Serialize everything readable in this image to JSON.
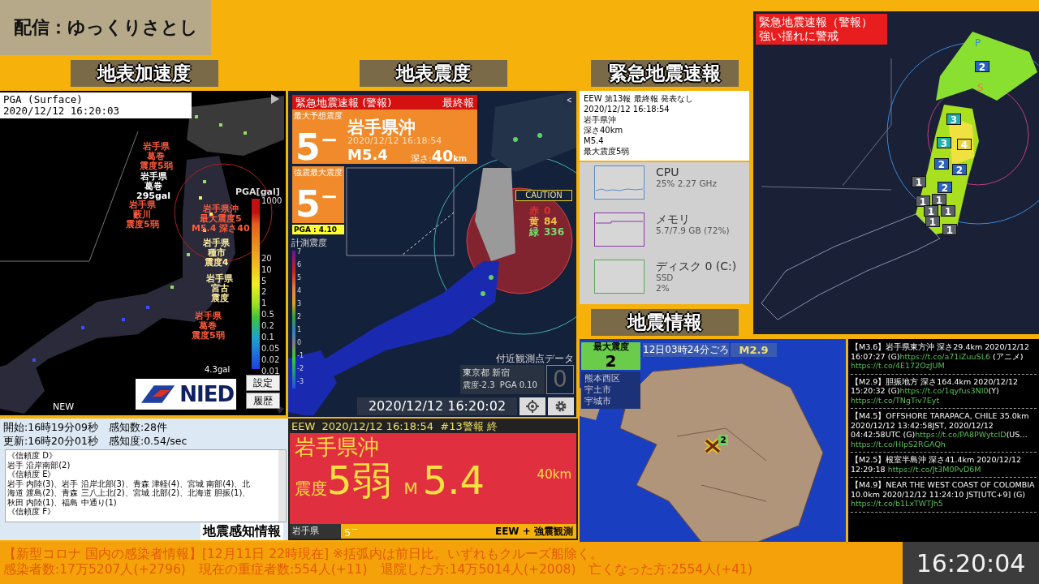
{
  "stream_banner": {
    "text": "配信：ゆっくりさとし"
  },
  "pga_panel": {
    "header": "地表加速度",
    "title": "PGA (Surface)",
    "timestamp": "2020/12/12 16:20:03",
    "scale_title": "PGA[gal]",
    "scale_ticks": [
      "1000",
      "20",
      "10",
      "5",
      "2",
      "1",
      "0.5",
      "0.2",
      "0.1",
      "0.05",
      "0.02",
      "0.01"
    ],
    "map_labels": [
      {
        "lines": [
          "岩手県",
          "葛巻",
          "震度5弱"
        ],
        "color": "#ff5a3c"
      },
      {
        "lines": [
          "岩手県",
          "葛巻",
          "295gal"
        ],
        "color": "#ffffff"
      },
      {
        "lines": [
          "岩手県",
          "藪川",
          "震度5弱"
        ],
        "color": "#ff5a3c"
      },
      {
        "lines": [
          "岩手県沖",
          "最大震度5",
          "M5.4 深さ40"
        ],
        "color": "#ff5a3c"
      },
      {
        "lines": [
          "岩手県",
          "種市",
          "震度4"
        ],
        "color": "#fff0a0"
      },
      {
        "lines": [
          "岩手県",
          "宮古",
          "震度"
        ],
        "color": "#fff0a0"
      },
      {
        "lines": [
          "岩手県",
          "葛巻",
          "震度5弱"
        ],
        "color": "#ff5a3c"
      }
    ],
    "peak_label": "4.3gal",
    "logo_text": "NIED",
    "new_label": "NEW",
    "buttons": [
      "設定",
      "履歴"
    ]
  },
  "shindo_panel": {
    "header": "地表震度",
    "alert_title": "緊急地震速報 (警報)",
    "alert_status": "最終報",
    "forecast_label": "最大予想震度",
    "forecast_value": "5$^{−}$",
    "region": "岩手県沖",
    "origin_time": "2020/12/12 16:18:54",
    "magnitude": "M5.4",
    "depth_label": "深さ:",
    "depth_value": "40",
    "depth_unit": "km",
    "observed_label": "強震最大震度",
    "observed_value": "5$^{−}$",
    "pga": "PGA : 4.10",
    "scale_title": "計測震度",
    "scale_ticks": [
      "7",
      "6",
      "5",
      "4",
      "3",
      "2",
      "1",
      "0",
      "-1",
      "-2",
      "-3"
    ],
    "caution": "CAUTION",
    "counts": [
      {
        "label": "赤",
        "value": "0",
        "color": "#e03030"
      },
      {
        "label": "黄",
        "value": "84",
        "color": "#f0c040"
      },
      {
        "label": "緑",
        "value": "336",
        "color": "#70e070"
      }
    ],
    "nearby_title": "付近観測点データ",
    "nearby_place": "東京都 新宿",
    "nearby_values": "震度-2.3  PGA 0.10",
    "nearby_intensity": "0",
    "current_time": "2020/12/12 16:20:02",
    "collapse": "<"
  },
  "eew_text_panel": {
    "header": "緊急地震速報",
    "lines": [
      "EEW 第13報 最終報 発表なし",
      "2020/12/12 16:18:54",
      "岩手県沖",
      "深さ40km",
      "M5.4",
      "最大震度5弱"
    ]
  },
  "performance": [
    {
      "name": "CPU",
      "details": [
        "25%  2.27 GHz"
      ],
      "color": "#5a8cc8"
    },
    {
      "name": "メモリ",
      "details": [
        "5.7/7.9 GB (72%)"
      ],
      "color": "#8a3aa8"
    },
    {
      "name": "ディスク 0 (C:)",
      "details": [
        "SSD",
        "2%"
      ],
      "color": "#5aa85a"
    }
  ],
  "right_map": {
    "alert_lines": [
      "緊急地震速報（警報）",
      "強い揺れに警戒"
    ],
    "wave_labels": [
      "P",
      "S"
    ],
    "markers": [
      {
        "label": "2",
        "color": "#2a64c0"
      },
      {
        "label": "3",
        "color": "#20b0b0"
      },
      {
        "label": "3",
        "color": "#20b0b0"
      },
      {
        "label": "4",
        "color": "#e8d040"
      },
      {
        "label": "2",
        "color": "#2a64c0"
      },
      {
        "label": "2",
        "color": "#2a64c0"
      },
      {
        "label": "1",
        "color": "#5a6068"
      },
      {
        "label": "2",
        "color": "#2a64c0"
      },
      {
        "label": "1",
        "color": "#5a6068"
      },
      {
        "label": "1",
        "color": "#5a6068"
      },
      {
        "label": "1",
        "color": "#5a6068"
      },
      {
        "label": "1",
        "color": "#5a6068"
      },
      {
        "label": "1",
        "color": "#5a6068"
      },
      {
        "label": "1",
        "color": "#5a6068"
      }
    ]
  },
  "quake_info": {
    "header": "地震情報",
    "max_label": "最大震度",
    "max_value": "2",
    "time": "12日03時24分ごろ",
    "magnitude": "M2.9",
    "areas": [
      "熊本西区",
      "宇土市",
      "宇城市"
    ],
    "epicenter_intensity": "2"
  },
  "quake_feed": [
    {
      "parts": [
        {
          "kind": "text",
          "text": "【M3.6】岩手県東方沖 深さ29.4km 2020/12/12 16:07:27 (G)"
        },
        {
          "kind": "link",
          "text": "https://t.co/a71iZuuSL6"
        },
        {
          "kind": "text",
          "text": " (アニメ)"
        },
        {
          "kind": "link",
          "text": "https://t.co/4E172OzJUM"
        }
      ]
    },
    {
      "parts": [
        {
          "kind": "text",
          "text": "【M2.9】胆振地方 深さ164.4km 2020/12/12 15:20:32 (G)"
        },
        {
          "kind": "link",
          "text": "https://t.co/1qyfus3NI0"
        },
        {
          "kind": "text",
          "text": "(Y)"
        },
        {
          "kind": "link",
          "text": "https://t.co/TNgTiv7Eyt"
        }
      ]
    },
    {
      "parts": [
        {
          "kind": "text",
          "text": "【M4.5】OFFSHORE TARAPACA, CHILE 35.0km 2020/12/12 13:42:58JST, 2020/12/12 04:42:58UTC (G)"
        },
        {
          "kind": "link",
          "text": "https://t.co/PA8PWytcID"
        },
        {
          "kind": "text",
          "text": "(US… "
        },
        {
          "kind": "link",
          "text": "https://t.co/HIpS2RGAQh"
        }
      ]
    },
    {
      "parts": [
        {
          "kind": "text",
          "text": "【M2.5】根室半島沖 深さ41.4km 2020/12/12 12:29:18 "
        },
        {
          "kind": "link",
          "text": "https://t.co/Jt3M0PvD6M"
        }
      ]
    },
    {
      "parts": [
        {
          "kind": "text",
          "text": "【M4.9】NEAR THE WEST COAST OF COLOMBIA 10.0km 2020/12/12 11:24:10 JST[UTC+9] (G)"
        },
        {
          "kind": "link",
          "text": "https://t.co/b1LxTWTJh5"
        }
      ]
    }
  ],
  "detection": {
    "stats": [
      "開始:16時19分09秒　感知数:28件",
      "更新:16時20分01秒　感知度:0.54/sec"
    ],
    "log": [
      "《信頼度 D》",
      "岩手 沿岸南部(2)",
      "《信頼度 E》",
      "岩手 内陸(3)、岩手 沿岸北部(3)、青森 津軽(4)、宮城 南部(4)、北",
      "海道 渡島(2)、青森 三八上北(2)、宮城 北部(2)、北海道 胆振(1)、",
      "秋田 内陸(1)、福島 中通り(1)",
      "《信頼度 F》"
    ],
    "title": "地震感知情報"
  },
  "eew_box": {
    "header": "EEW  2020/12/12 16:18:54  #13警報 終",
    "region": "岩手県沖",
    "intensity_label": "震度",
    "intensity": "5弱",
    "magnitude_prefix": "M",
    "magnitude": "5.4",
    "depth": "40km",
    "prefecture": "岩手県",
    "prefecture_intensity": "5$^{−}$",
    "source": "EEW + 強震観測"
  },
  "ticker": {
    "lines": [
      "【新型コロナ 国内の感染者情報】[12月11日 22時現在] ※括弧内は前日比。いずれもクルーズ船除く。",
      "感染者数:17万5207人(+2796)　現在の重症者数:554人(+11)　退院した方:14万5014人(+2008)　亡くなった方:2554人(+41)"
    ],
    "clock": "16:20:04"
  }
}
